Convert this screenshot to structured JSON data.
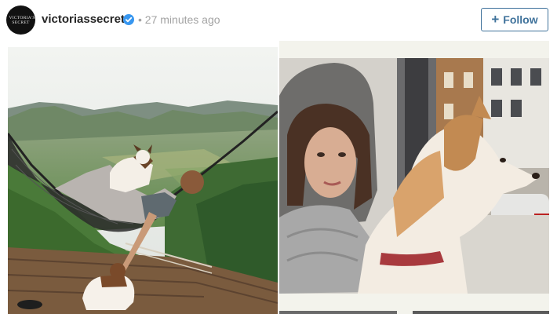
{
  "post": {
    "avatar_text": "VICTORIA'S SECRET",
    "username": "victoriassecret",
    "separator": "•",
    "time": "27 minutes ago",
    "follow_label": "Follow",
    "follow_icon": "plus-icon",
    "verified_icon": "verified-badge-icon"
  },
  "photos": [
    {
      "name": "hammock-mountain-photo"
    },
    {
      "name": "car-dog-photo"
    }
  ],
  "colors": {
    "accent": "#3f729b",
    "verified": "#3897f0",
    "username": "#262626",
    "time": "#a3a3a3"
  }
}
